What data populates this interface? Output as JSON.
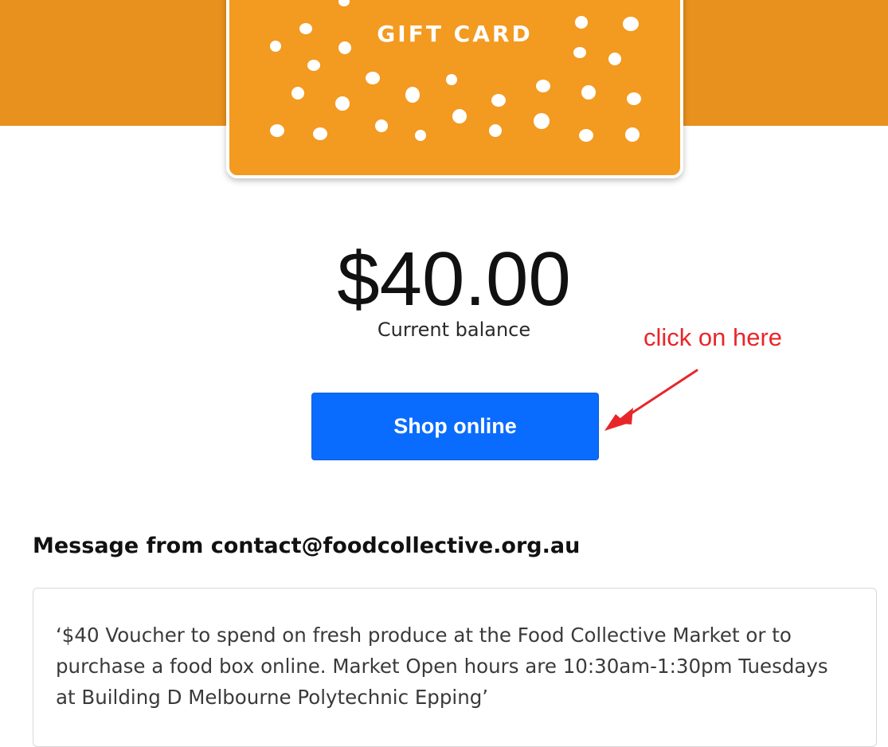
{
  "gift_card": {
    "title": "GIFT CARD",
    "card_color": "#f39a21",
    "band_color": "#e8911e"
  },
  "balance": {
    "amount": "$40.00",
    "label": "Current balance"
  },
  "shop_button": {
    "label": "Shop online",
    "color": "#0a6cff"
  },
  "annotation": {
    "text": "click on here",
    "color": "#e8262a"
  },
  "message": {
    "heading": "Message from contact@foodcollective.org.au",
    "body": "‘$40 Voucher to spend on fresh produce at the Food Collective Market or to purchase a food box online. Market Open hours are 10:30am-1:30pm Tuesdays at Building D Melbourne Polytechnic Epping’"
  }
}
